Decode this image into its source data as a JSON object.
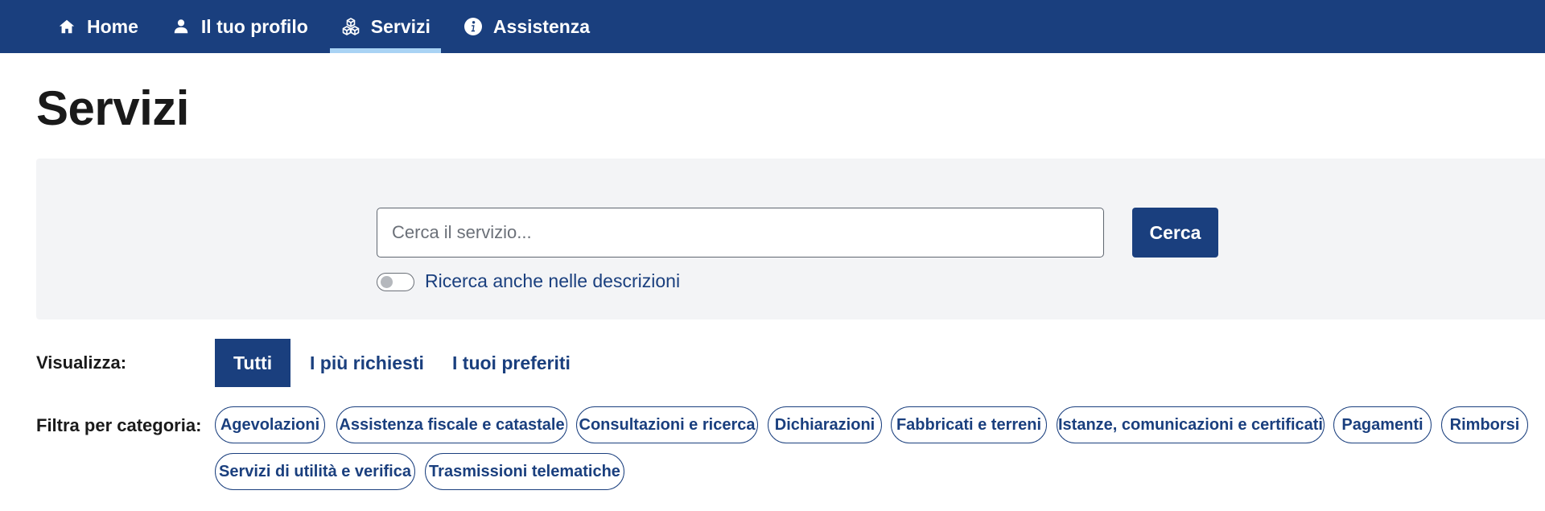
{
  "nav": {
    "items": [
      {
        "label": "Home",
        "icon": "home-icon"
      },
      {
        "label": "Il tuo profilo",
        "icon": "user-icon"
      },
      {
        "label": "Servizi",
        "icon": "cubes-icon"
      },
      {
        "label": "Assistenza",
        "icon": "info-icon"
      }
    ],
    "active": "Servizi"
  },
  "page": {
    "title": "Servizi"
  },
  "search": {
    "placeholder": "Cerca il servizio...",
    "value": "",
    "button_label": "Cerca",
    "toggle_label": "Ricerca anche nelle descrizioni",
    "toggle_on": false
  },
  "view": {
    "label": "Visualizza:",
    "tabs": [
      "Tutti",
      "I più richiesti",
      "I tuoi preferiti"
    ],
    "active": "Tutti"
  },
  "filters": {
    "label": "Filtra per categoria:",
    "categories": [
      "Agevolazioni",
      "Assistenza fiscale e catastale",
      "Consultazioni e ricerca",
      "Dichiarazioni",
      "Fabbricati e terreni",
      "Istanze, comunicazioni e certificati",
      "Pagamenti",
      "Rimborsi",
      "Servizi di utilità e verifica",
      "Trasmissioni telematiche"
    ]
  },
  "colors": {
    "primary": "#1a3f7e",
    "nav_active_underline": "#a9d3f4",
    "panel_bg": "#f3f4f6",
    "text_dark": "#1a1a1a"
  }
}
